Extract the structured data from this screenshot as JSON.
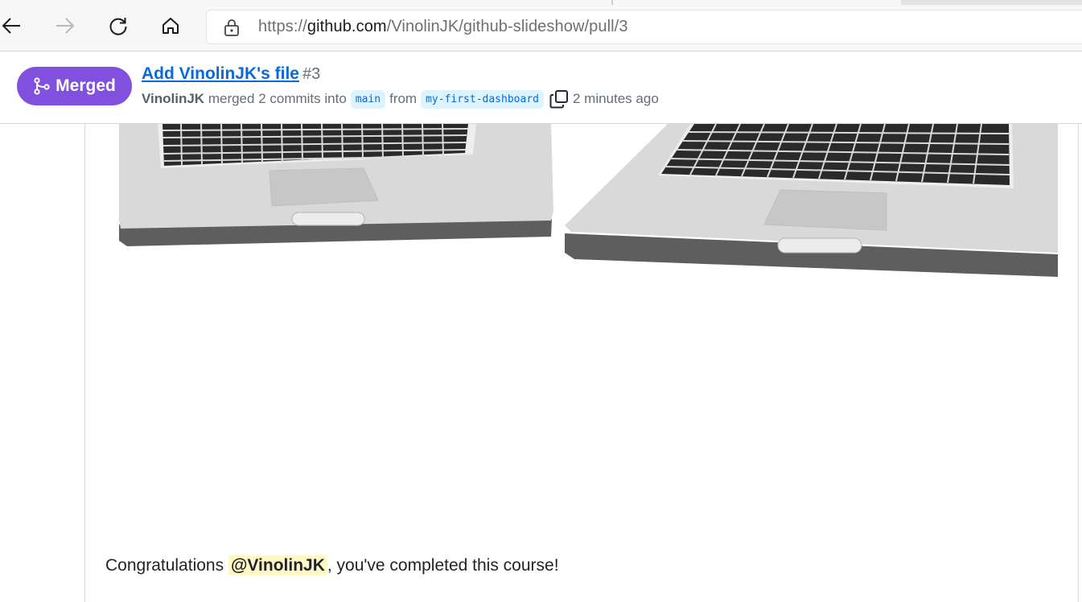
{
  "browser": {
    "url_prefix": "https://",
    "url_host": "github.com",
    "url_path": "/VinolinJK/github-slideshow/pull/3",
    "icons": {
      "back": "arrow-left-icon",
      "forward": "arrow-right-icon",
      "refresh": "refresh-icon",
      "home": "home-icon",
      "lock": "lock-icon"
    }
  },
  "pr_header": {
    "status_label": "Merged",
    "status_color": "#8250df",
    "title": "Add VinolinJK's file",
    "number": "#3",
    "author": "VinolinJK",
    "merged_text": "merged 2 commits into",
    "base_branch": "main",
    "from_text": "from",
    "head_branch": "my-first-dashboard",
    "time_text": "2 minutes ago"
  },
  "comment": {
    "prefix": "Congratulations",
    "mention": "@VinolinJK",
    "suffix": ", you've completed this course!"
  }
}
